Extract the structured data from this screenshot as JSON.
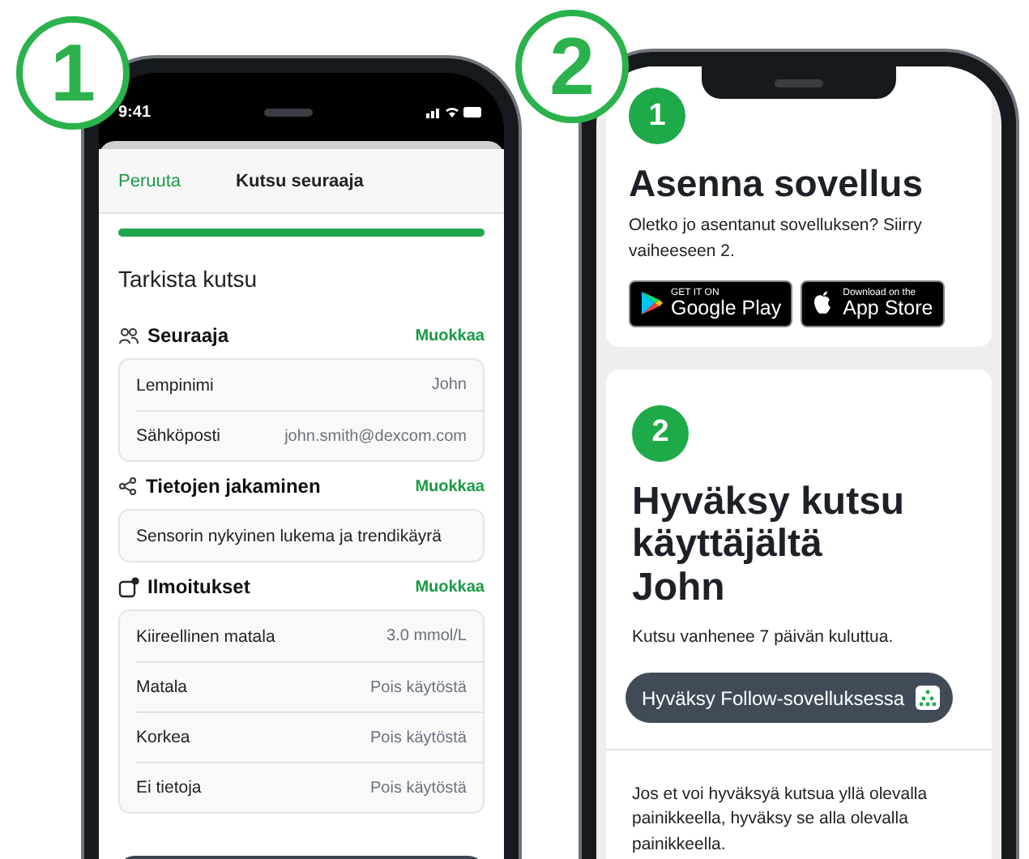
{
  "badges": [
    "1",
    "2"
  ],
  "phone_1": {
    "status_time": "9:41",
    "header": {
      "cancel": "Peruuta",
      "title": "Kutsu seuraaja"
    },
    "progress": {
      "level": 1
    },
    "heading": "Tarkista kutsu",
    "sections": [
      {
        "kind": "people",
        "title": "Seuraaja",
        "action": "Muokkaa",
        "rows": [
          {
            "label": "Lempinimi",
            "value": "John"
          },
          {
            "label": "Sähköposti",
            "value": "john.smith@dexcom.com"
          }
        ]
      },
      {
        "kind": "share",
        "title": "Tietojen jakaminen",
        "action": "Muokkaa",
        "rows": [
          {
            "label": "Sensorin nykyinen lukema ja trendikäyrä"
          }
        ]
      },
      {
        "kind": "notification",
        "title": "Ilmoitukset",
        "action": "Muokkaa",
        "rows": [
          {
            "label": "Kiireellinen matala",
            "value": "3.0 mmol/L"
          },
          {
            "label": "Matala",
            "value": "Pois käytöstä"
          },
          {
            "label": "Korkea",
            "value": "Pois käytöstä"
          },
          {
            "label": "Ei tietoja",
            "value": "Pois käytöstä"
          }
        ]
      }
    ]
  },
  "phone_2": {
    "cards": [
      {
        "step": "1",
        "title": "Asenna sovellus",
        "text": "Oletko jo asentanut sovelluksen? Siirry vaiheeseen 2.",
        "stores": [
          {
            "kind": "google",
            "small": "GET IT ON",
            "big": "Google Play"
          },
          {
            "kind": "apple",
            "small": "Download on the",
            "big": "App Store"
          }
        ]
      },
      {
        "step": "2",
        "title": "Hyväksy kutsu\nkäyttäjältä\nJohn",
        "text": "Kutsu vanhenee 7 päivän kuluttua.",
        "button": "Hyväksy Follow-sovelluksessa",
        "note": "Jos et voi hyväksyä kutsua yllä olevalla painikkeella, hyväksy se alla olevalla painikkeella."
      }
    ]
  }
}
